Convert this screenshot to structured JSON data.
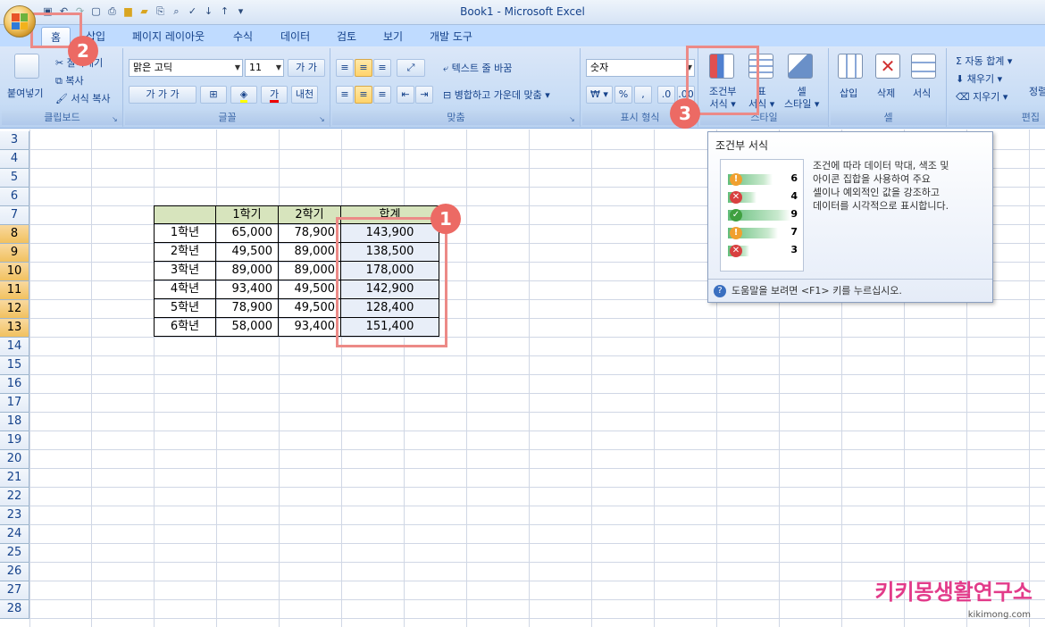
{
  "window": {
    "title": "Book1 - Microsoft Excel"
  },
  "tabs": [
    "홈",
    "삽입",
    "페이지 레이아웃",
    "수식",
    "데이터",
    "검토",
    "보기",
    "개발 도구"
  ],
  "ribbon": {
    "clipboard": {
      "label": "클립보드",
      "paste": "붙여넣기",
      "cut": "잘라내기",
      "copy": "복사",
      "format_painter": "서식 복사"
    },
    "font": {
      "label": "글꼴",
      "font_name": "맑은 고딕",
      "font_size": "11"
    },
    "alignment": {
      "label": "맞춤",
      "wrap_text": "텍스트 줄 바꿈",
      "merge_center": "병합하고 가운데 맞춤"
    },
    "number": {
      "label": "표시 형식",
      "format": "숫자"
    },
    "styles": {
      "label": "스타일",
      "conditional_formatting_1": "조건부",
      "conditional_formatting_2": "서식",
      "format_as_table_1": "표",
      "format_as_table_2": "서식",
      "cell_styles_1": "셀",
      "cell_styles_2": "스타일"
    },
    "cells": {
      "label": "셀",
      "insert": "삽입",
      "delete": "삭제",
      "format": "서식"
    },
    "editing": {
      "label": "편집",
      "autosum": "자동 합계",
      "fill": "채우기",
      "clear": "지우기",
      "sort": "정렬"
    }
  },
  "rows": [
    "3",
    "4",
    "5",
    "6",
    "7",
    "8",
    "9",
    "10",
    "11",
    "12",
    "13",
    "14",
    "15",
    "16",
    "17",
    "18",
    "19",
    "20",
    "21",
    "22",
    "23",
    "24",
    "25",
    "26",
    "27",
    "28"
  ],
  "table": {
    "headers": [
      "",
      "1학기",
      "2학기",
      "합계"
    ],
    "data": [
      [
        "1학년",
        "65,000",
        "78,900",
        "143,900"
      ],
      [
        "2학년",
        "49,500",
        "89,000",
        "138,500"
      ],
      [
        "3학년",
        "89,000",
        "89,000",
        "178,000"
      ],
      [
        "4학년",
        "93,400",
        "49,500",
        "142,900"
      ],
      [
        "5학년",
        "78,900",
        "49,500",
        "128,400"
      ],
      [
        "6학년",
        "58,000",
        "93,400",
        "151,400"
      ]
    ]
  },
  "tooltip": {
    "title": "조건부 서식",
    "description": "조건에 따라 데이터 막대, 색조 및\n아이콘 집합을 사용하여 주요\n셀이나 예외적인 값을 강조하고\n데이터를 시각적으로 표시합니다.",
    "preview_values": [
      "6",
      "4",
      "9",
      "7",
      "3"
    ],
    "footer": "도움말을 보려면 <F1> 키를 누르십시오."
  },
  "badges": [
    "1",
    "2",
    "3"
  ],
  "watermark": {
    "main": "키키몽생활연구소",
    "sub": "kikimong.com"
  }
}
